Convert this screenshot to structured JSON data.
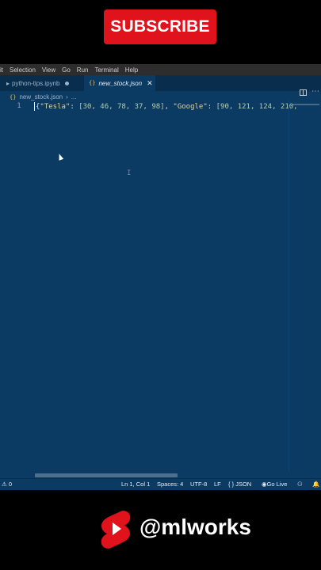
{
  "overlay": {
    "subscribe_label": "SUBSCRIBE",
    "channel_handle": "@mlworks",
    "shorts_logo_color": "#e0121b"
  },
  "menubar": {
    "items": [
      "it",
      "Selection",
      "View",
      "Go",
      "Run",
      "Terminal",
      "Help"
    ]
  },
  "tabs": [
    {
      "label": "python-tips.ipynb",
      "modified": true
    },
    {
      "label": "new_stock.json",
      "active": true
    }
  ],
  "breadcrumb": {
    "file": "new_stock.json",
    "trail": "..."
  },
  "editor": {
    "line_number": "1",
    "code": {
      "brace": "{",
      "key1": "\"Tesla\"",
      "values1": "[30, 46, 78, 37, 98]",
      "sep": ", ",
      "key2": "\"Google\"",
      "values2": "[90, 121, 124, 210,"
    }
  },
  "statusbar": {
    "errors": "0",
    "position": "Ln 1, Col 1",
    "spaces": "Spaces: 4",
    "encoding": "UTF-8",
    "eol": "LF",
    "language": "JSON",
    "go_live": "Go Live"
  },
  "colors": {
    "editor_bg": "#0b3a63",
    "accent_red": "#e0121b",
    "json_brace_icon": "#e0c46c"
  }
}
